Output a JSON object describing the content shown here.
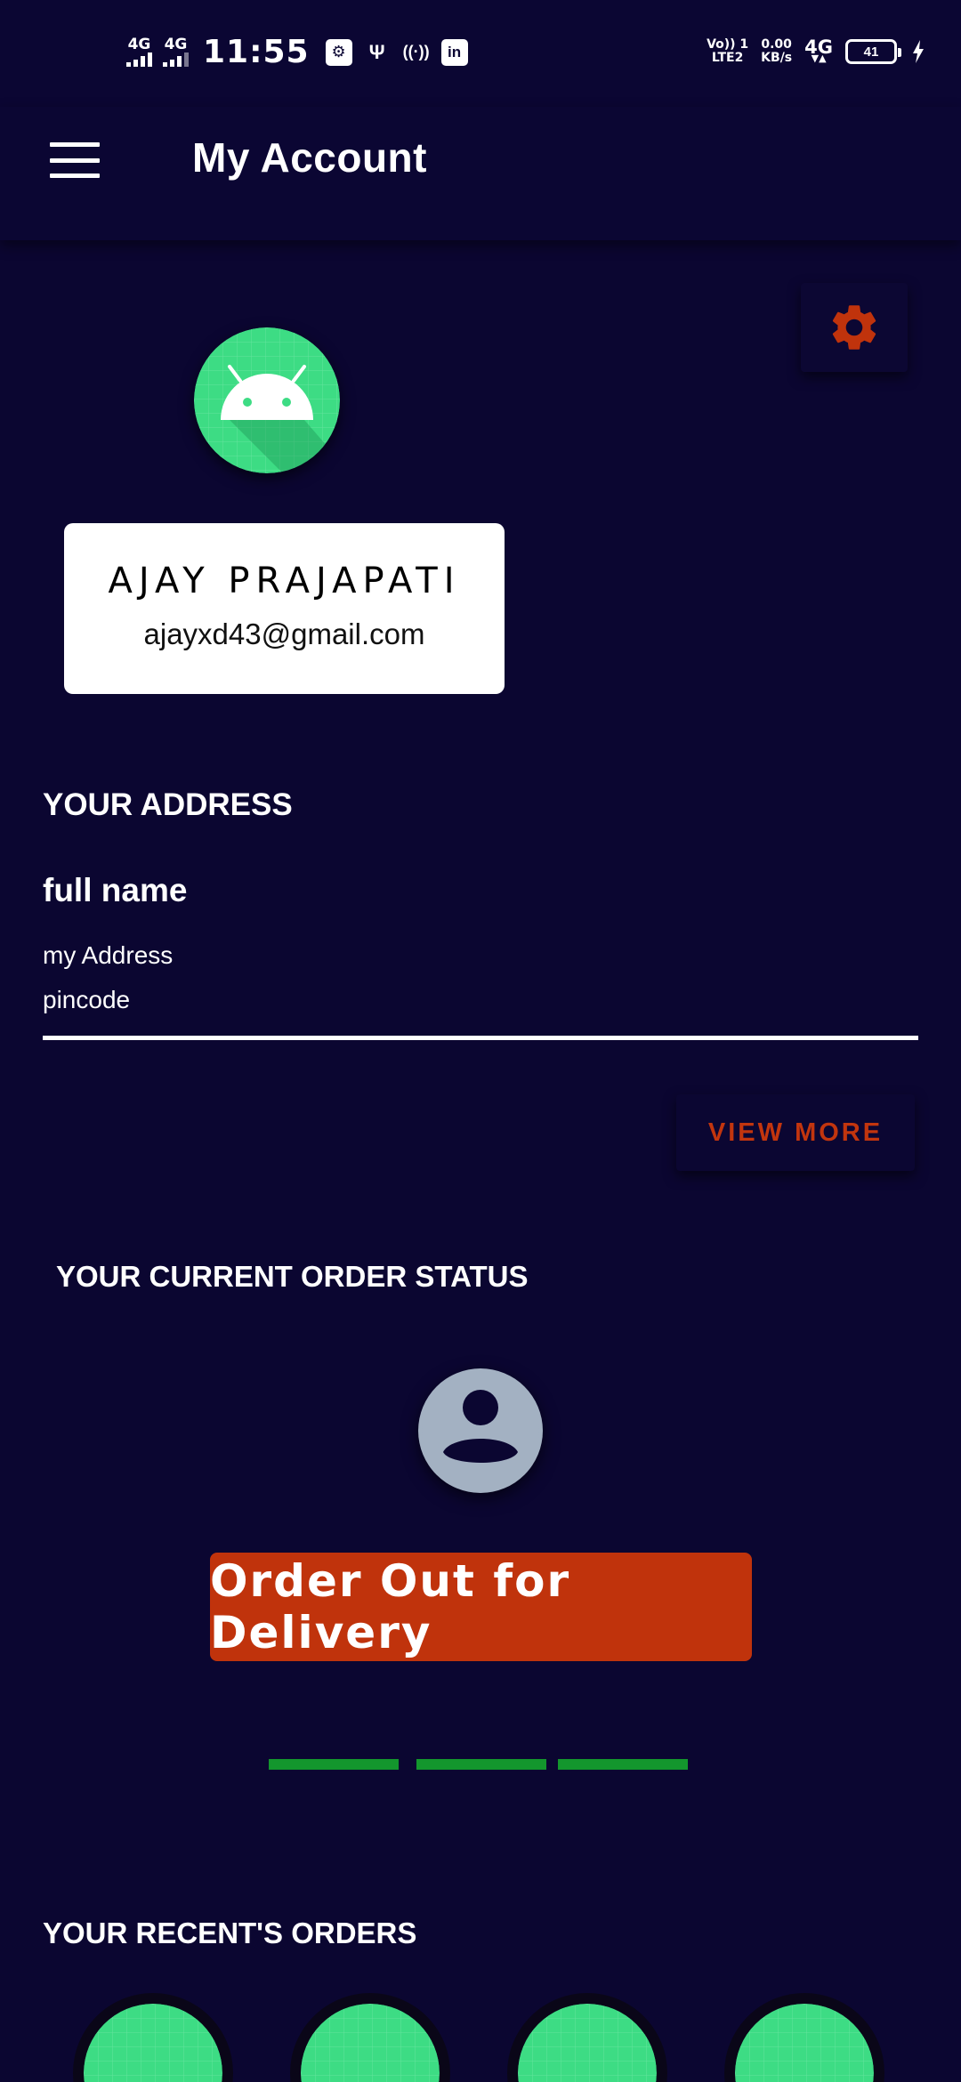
{
  "status_bar": {
    "network1": "4G",
    "network2": "4G",
    "time": "11:55",
    "volte_top": "Vo)) 1",
    "volte_bottom": "LTE2",
    "speed_top": "0.00",
    "speed_bottom": "KB/s",
    "network3": "4G",
    "battery_level": "41"
  },
  "toolbar": {
    "title": "My Account"
  },
  "profile": {
    "name": "AJAY PRAJAPATI",
    "email": "ajayxd43@gmail.com"
  },
  "address": {
    "section_title": "YOUR ADDRESS",
    "full_name": "full name",
    "line": "my Address",
    "pincode": "pincode",
    "view_more": "VIEW MORE"
  },
  "order_status": {
    "section_title": "YOUR CURRENT ORDER STATUS",
    "status_label": "Order Out for Delivery",
    "progress_steps_done": 3
  },
  "recent_orders": {
    "section_title": "YOUR RECENT'S ORDERS"
  },
  "colors": {
    "background": "#0b0631",
    "accent": "#c0330c",
    "progress": "#13962d",
    "android_green": "#3ddc84"
  },
  "icons": {
    "menu": "hamburger-menu-icon",
    "settings": "gear-icon",
    "profile": "android-avatar",
    "status": "person-icon"
  }
}
